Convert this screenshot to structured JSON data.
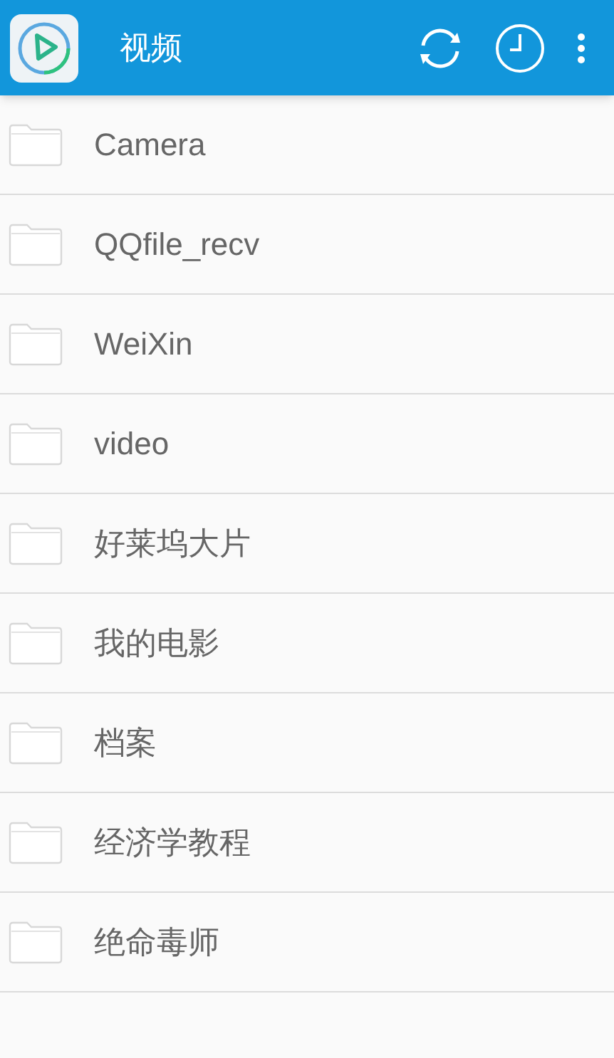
{
  "app_bar": {
    "title": "视频"
  },
  "folders": [
    {
      "name": "Camera"
    },
    {
      "name": "QQfile_recv"
    },
    {
      "name": "WeiXin"
    },
    {
      "name": "video"
    },
    {
      "name": "好莱坞大片"
    },
    {
      "name": "我的电影"
    },
    {
      "name": "档案"
    },
    {
      "name": "经济学教程"
    },
    {
      "name": "绝命毒师"
    }
  ]
}
